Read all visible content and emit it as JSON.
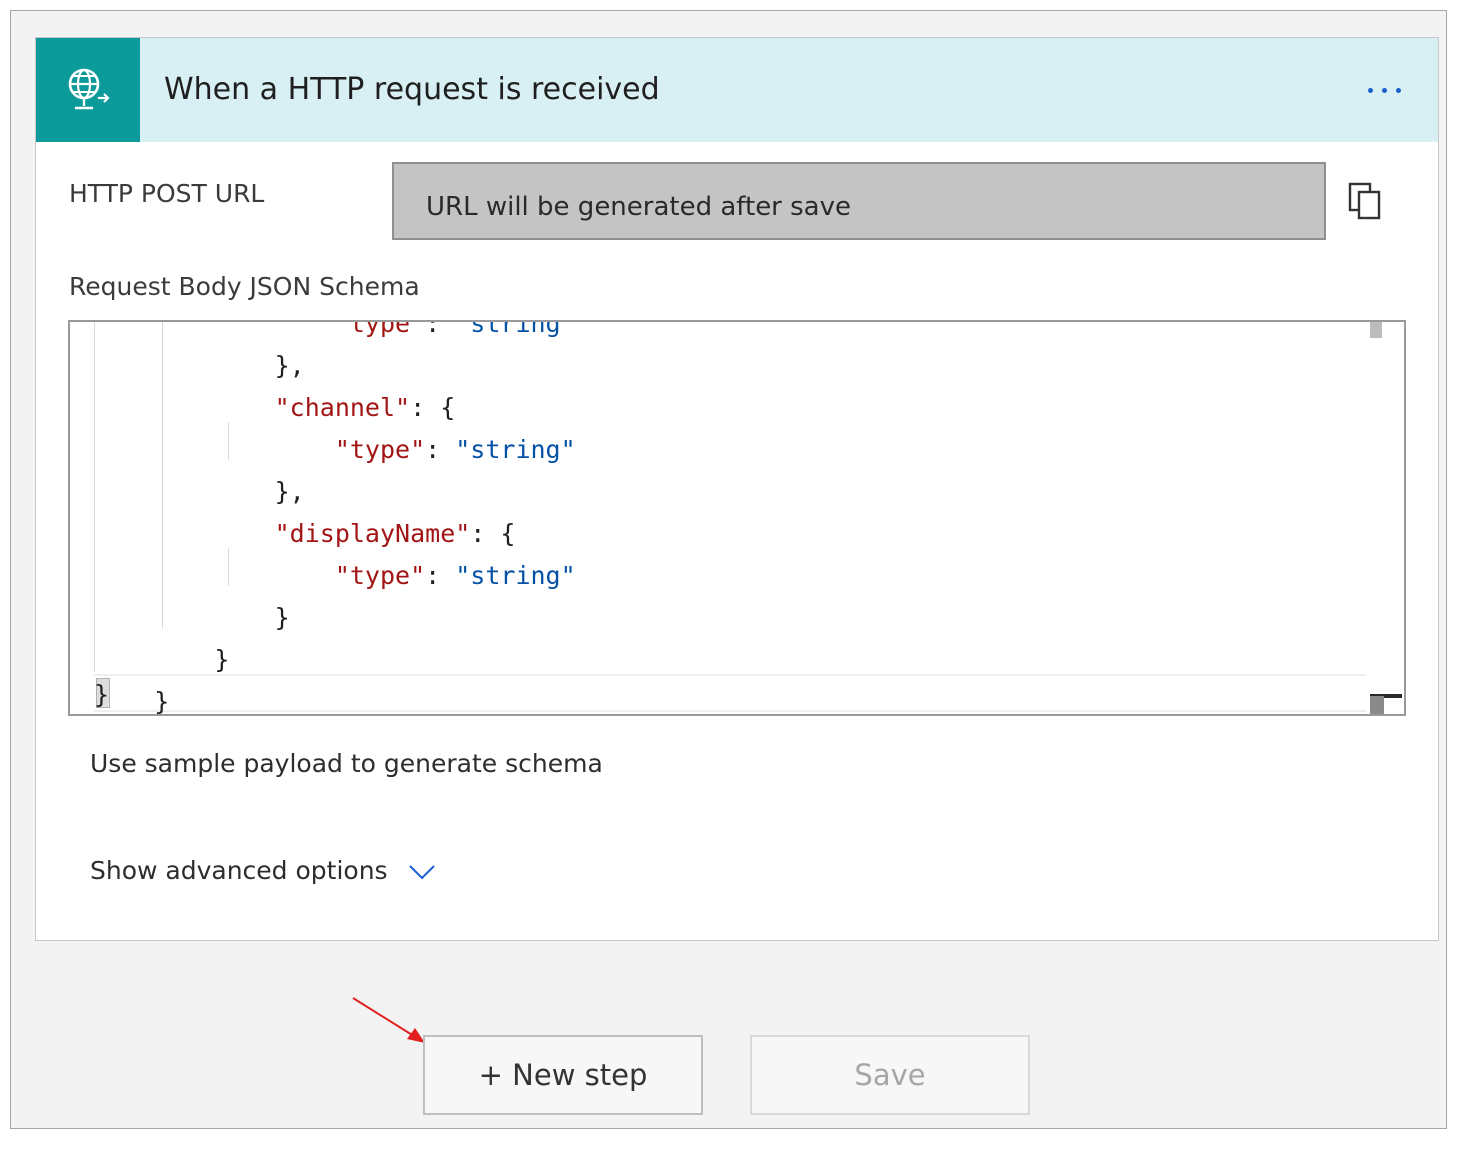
{
  "trigger_card": {
    "icon": "http-request-globe-icon",
    "title": "When a HTTP request is received",
    "http_post_url": {
      "label": "HTTP POST URL",
      "value": "URL will be generated after save",
      "copy_icon": "copy-icon"
    },
    "schema": {
      "label": "Request Body JSON Schema",
      "lines": [
        {
          "indent": "                ",
          "parts": [
            {
              "t": "k",
              "v": "\"type\""
            },
            {
              "t": "p",
              "v": ": "
            },
            {
              "t": "s",
              "v": "\"string\""
            }
          ]
        },
        {
          "indent": "            ",
          "parts": [
            {
              "t": "p",
              "v": "},"
            }
          ]
        },
        {
          "indent": "            ",
          "parts": [
            {
              "t": "k",
              "v": "\"channel\""
            },
            {
              "t": "p",
              "v": ": {"
            }
          ]
        },
        {
          "indent": "                ",
          "parts": [
            {
              "t": "k",
              "v": "\"type\""
            },
            {
              "t": "p",
              "v": ": "
            },
            {
              "t": "s",
              "v": "\"string\""
            }
          ]
        },
        {
          "indent": "            ",
          "parts": [
            {
              "t": "p",
              "v": "},"
            }
          ]
        },
        {
          "indent": "            ",
          "parts": [
            {
              "t": "k",
              "v": "\"displayName\""
            },
            {
              "t": "p",
              "v": ": {"
            }
          ]
        },
        {
          "indent": "                ",
          "parts": [
            {
              "t": "k",
              "v": "\"type\""
            },
            {
              "t": "p",
              "v": ": "
            },
            {
              "t": "s",
              "v": "\"string\""
            }
          ]
        },
        {
          "indent": "            ",
          "parts": [
            {
              "t": "p",
              "v": "}"
            }
          ]
        },
        {
          "indent": "        ",
          "parts": [
            {
              "t": "p",
              "v": "}"
            }
          ]
        },
        {
          "indent": "    ",
          "parts": [
            {
              "t": "p",
              "v": "}"
            }
          ]
        }
      ]
    },
    "sample_payload_link": "Use sample payload to generate schema",
    "advanced_options_link": "Show advanced options"
  },
  "actions": {
    "new_step_label": "+ New step",
    "save_label": "Save"
  },
  "colors": {
    "header_bg": "#d8eff3",
    "icon_bg": "#0d9a9a",
    "accent": "#1a5fd0",
    "json_key": "#a31515",
    "json_string": "#0451a5"
  }
}
